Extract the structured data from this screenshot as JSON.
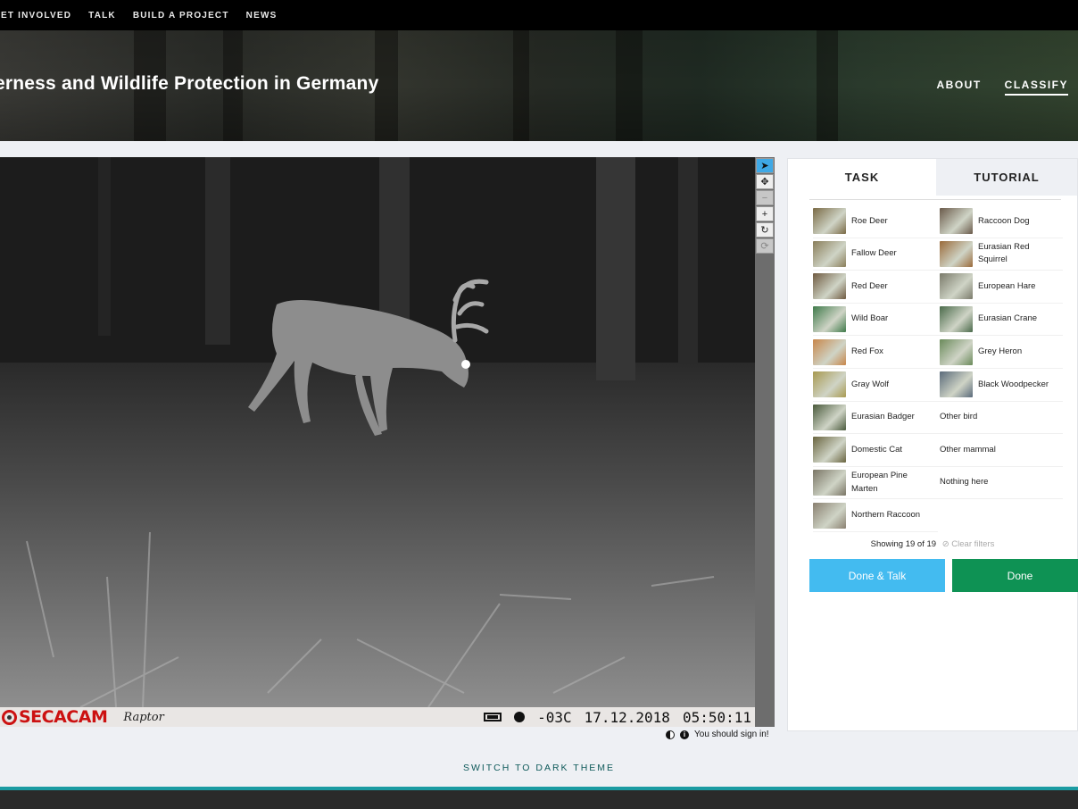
{
  "topnav": {
    "items": [
      "GET INVOLVED",
      "TALK",
      "BUILD A PROJECT",
      "NEWS"
    ]
  },
  "hero": {
    "title": "erness and Wildlife Protection in Germany",
    "links": [
      "ABOUT",
      "CLASSIFY"
    ],
    "active_link": "CLASSIFY"
  },
  "viewer": {
    "camera_brand": "SECACAM",
    "camera_model": "Raptor",
    "temperature": "-03C",
    "date": "17.12.2018",
    "time": "05:50:11",
    "tools": [
      {
        "name": "pointer-icon",
        "glyph": "➤",
        "state": "active"
      },
      {
        "name": "move-icon",
        "glyph": "✥",
        "state": "normal"
      },
      {
        "name": "zoom-out-icon",
        "glyph": "−",
        "state": "disabled"
      },
      {
        "name": "zoom-in-icon",
        "glyph": "+",
        "state": "normal"
      },
      {
        "name": "rotate-icon",
        "glyph": "↻",
        "state": "normal"
      },
      {
        "name": "reset-icon",
        "glyph": "⟳",
        "state": "disabled"
      }
    ],
    "signin_message": "You should sign in!"
  },
  "task": {
    "tabs": [
      "TASK",
      "TUTORIAL"
    ],
    "choices_left": [
      {
        "label": "Roe Deer",
        "color": "#7a6a45"
      },
      {
        "label": "Fallow Deer",
        "color": "#8a7e5a"
      },
      {
        "label": "Red Deer",
        "color": "#6f5a40"
      },
      {
        "label": "Wild Boar",
        "color": "#3f7a4a"
      },
      {
        "label": "Red Fox",
        "color": "#c8864a"
      },
      {
        "label": "Gray Wolf",
        "color": "#a89a50"
      },
      {
        "label": "Eurasian Badger",
        "color": "#4a5a3c"
      },
      {
        "label": "Domestic Cat",
        "color": "#6a6540"
      },
      {
        "label": "European Pine Marten",
        "color": "#7a7565"
      },
      {
        "label": "Northern Raccoon",
        "color": "#8a8070"
      }
    ],
    "choices_right": [
      {
        "label": "Raccoon Dog",
        "color": "#6a5a4a",
        "has_thumb": true
      },
      {
        "label": "Eurasian Red Squirrel",
        "color": "#9a6a3a",
        "has_thumb": true
      },
      {
        "label": "European Hare",
        "color": "#7a7a6a",
        "has_thumb": true
      },
      {
        "label": "Eurasian Crane",
        "color": "#4a6a4a",
        "has_thumb": true
      },
      {
        "label": "Grey Heron",
        "color": "#6a8a5a",
        "has_thumb": true
      },
      {
        "label": "Black Woodpecker",
        "color": "#5a6a7a",
        "has_thumb": true
      },
      {
        "label": "Other bird",
        "has_thumb": false
      },
      {
        "label": "Other mammal",
        "has_thumb": false
      },
      {
        "label": "Nothing here",
        "has_thumb": false
      }
    ],
    "showing": "Showing 19 of 19",
    "clear_filters": "⊘ Clear filters",
    "done_talk_label": "Done & Talk",
    "done_label": "Done"
  },
  "theme_switch": "SWITCH TO DARK THEME"
}
